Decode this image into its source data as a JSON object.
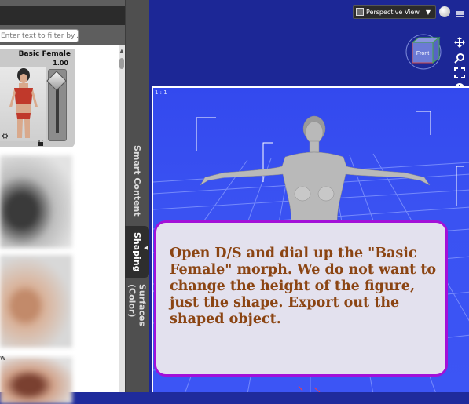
{
  "left_panel": {
    "filter_placeholder": "Enter text to filter by...",
    "morph": {
      "title": "Basic Female",
      "value": "1.00"
    },
    "partial_label": "w"
  },
  "tabs": [
    {
      "label": "Smart Content"
    },
    {
      "label": "Shaping"
    },
    {
      "label": "Surfaces (Color)"
    }
  ],
  "viewport": {
    "view_label": "Perspective View",
    "cube_face": "Front",
    "camera_label": "1 : 1"
  },
  "callout": {
    "text": "Open D/S and dial up the \"Basic Female\" morph. We do not want to change the height of the figure, just the shape. Export out the shaped object."
  },
  "colors": {
    "viewport_blue": "#3a52f2",
    "callout_border": "#a310d8",
    "callout_text": "#8b4513"
  },
  "icons": [
    "menu-icon",
    "gear-icon",
    "lock-icon",
    "view-icon",
    "dropdown-icon",
    "globe-icon",
    "move-icon",
    "zoom-icon",
    "frame-icon",
    "pivot-icon"
  ]
}
